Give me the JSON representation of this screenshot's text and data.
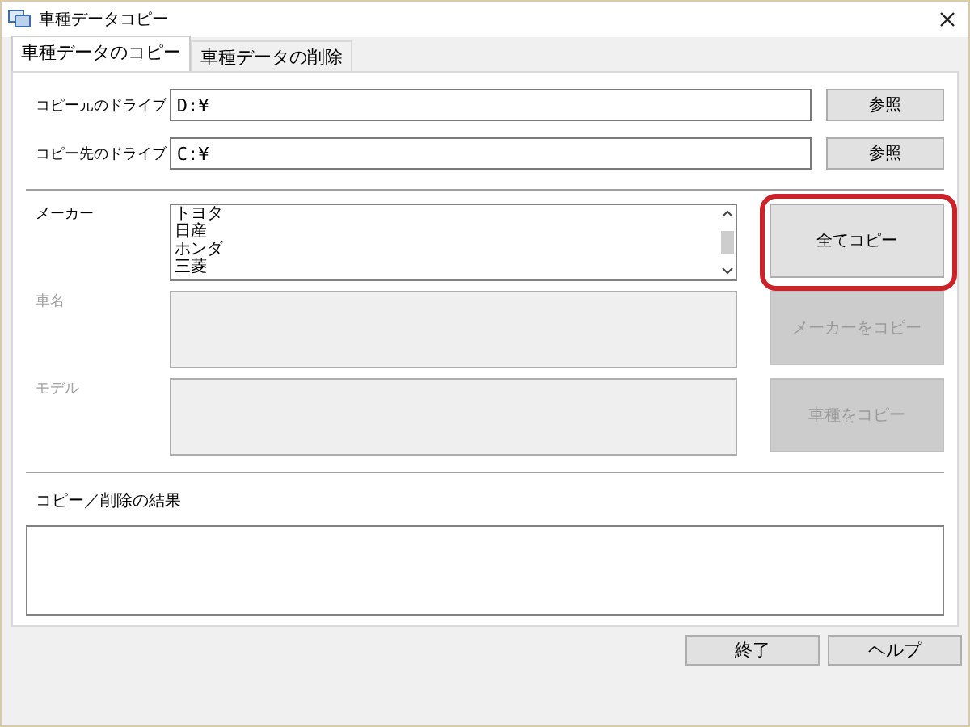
{
  "window": {
    "title": "車種データコピー"
  },
  "tabs": [
    {
      "label": "車種データのコピー",
      "selected": true
    },
    {
      "label": "車種データの削除",
      "selected": false
    }
  ],
  "drives": [
    {
      "label": "コピー元のドライブ",
      "value": "D:¥",
      "button": "参照"
    },
    {
      "label": "コピー先のドライブ",
      "value": "C:¥",
      "button": "参照"
    }
  ],
  "lists": [
    {
      "label": "メーカー",
      "disabled": false,
      "items": [
        "トヨタ",
        "日産",
        "ホンダ",
        "三菱"
      ],
      "button": "全てコピー",
      "button_disabled": false,
      "highlighted": true
    },
    {
      "label": "車名",
      "disabled": true,
      "button": "メーカーをコピー",
      "button_disabled": true,
      "highlighted": false
    },
    {
      "label": "モデル",
      "disabled": true,
      "button": "車種をコピー",
      "button_disabled": true,
      "highlighted": false
    }
  ],
  "result": {
    "label": "コピー／削除の結果"
  },
  "footer_buttons": [
    "終了",
    "ヘルプ"
  ]
}
